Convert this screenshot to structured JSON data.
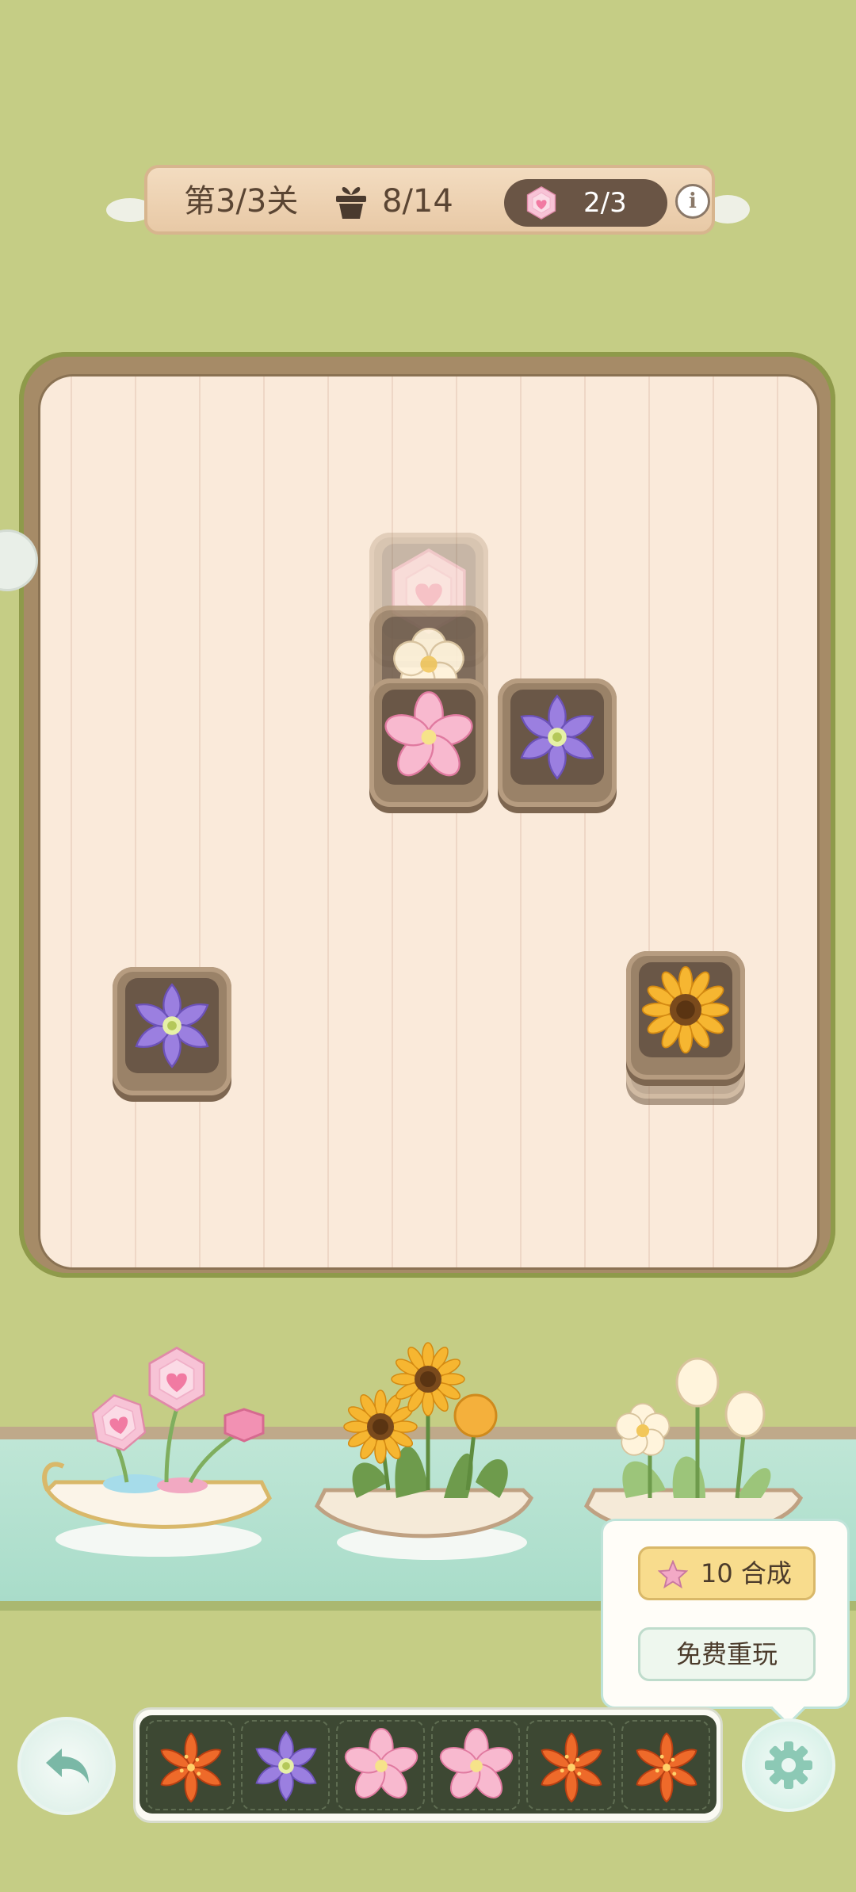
{
  "status_bar": {
    "level_label": "第3/3关",
    "gift_icon": "flowerpot-icon",
    "gift_count": "8/14",
    "gem_icon": "pink-gem-icon",
    "gem_count": "2/3",
    "info_icon": "info-icon",
    "info_glyph": "i"
  },
  "board": {
    "tiles": [
      {
        "flower": "pink-gem-icon",
        "state": "locked"
      },
      {
        "flower": "white-plum-flower-icon",
        "state": "partially-covered"
      },
      {
        "flower": "pink-blossom-icon",
        "state": "free"
      },
      {
        "flower": "purple-clematis-icon",
        "state": "free"
      },
      {
        "flower": "purple-clematis-icon",
        "state": "free"
      },
      {
        "flower": "sunflower-icon",
        "state": "free"
      }
    ]
  },
  "scenery": {
    "boats": [
      "pink-gem-flower-boat",
      "sunflower-boat",
      "white-flower-boat"
    ]
  },
  "popup_menu": {
    "merge_cost": "10",
    "merge_label": "合成",
    "merge_icon": "star-icon",
    "replay_label": "免费重玩"
  },
  "tray": {
    "slots": [
      "orange-lily-icon",
      "purple-clematis-icon",
      "pink-blossom-icon",
      "pink-blossom-icon",
      "orange-lily-icon",
      "orange-lily-icon"
    ]
  },
  "controls": {
    "undo_icon": "undo-icon",
    "settings_icon": "gear-icon"
  },
  "colors": {
    "background": "#c5cd85",
    "board": "#faeada",
    "tile": "#9a8268",
    "tray": "#3d4833",
    "merge_button": "#f8dc8d"
  }
}
